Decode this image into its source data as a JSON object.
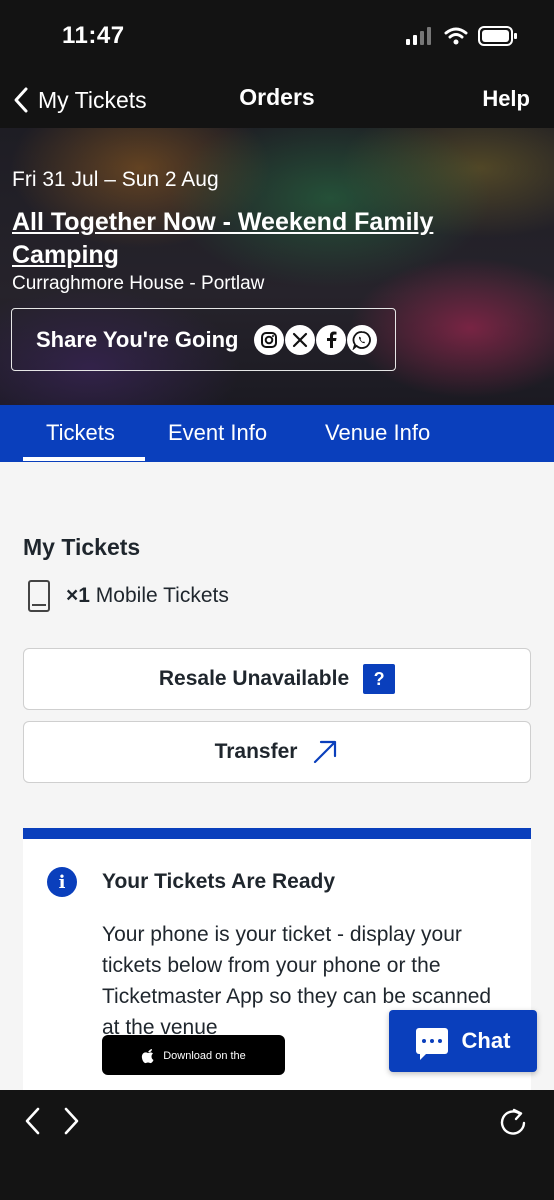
{
  "status_bar": {
    "time": "11:47"
  },
  "nav": {
    "back_label": "My Tickets",
    "title": "Orders",
    "help_label": "Help"
  },
  "event": {
    "dates": "Fri 31 Jul – Sun 2 Aug",
    "title": "All Together Now - Weekend Family Camping",
    "venue": "Curraghmore House - Portlaw",
    "share_label": "Share You're Going",
    "share_networks": [
      "instagram",
      "x",
      "facebook",
      "whatsapp"
    ]
  },
  "tabs": [
    {
      "label": "Tickets",
      "active": true
    },
    {
      "label": "Event Info",
      "active": false
    },
    {
      "label": "Venue Info",
      "active": false
    }
  ],
  "tickets": {
    "section_title": "My Tickets",
    "count": "×1",
    "count_label": "Mobile Tickets",
    "resale_label": "Resale Unavailable",
    "resale_help": "?",
    "transfer_label": "Transfer"
  },
  "info_card": {
    "icon": "i",
    "title": "Your Tickets Are Ready",
    "body": "Your phone is your ticket - display your tickets below from your phone or the Ticketmaster App so they can be scanned at the venue",
    "app_store_label": "Download on the"
  },
  "chat": {
    "label": "Chat"
  },
  "colors": {
    "brand_blue": "#0a3fbc",
    "background": "#f5f5f5",
    "text": "#1f262d"
  }
}
